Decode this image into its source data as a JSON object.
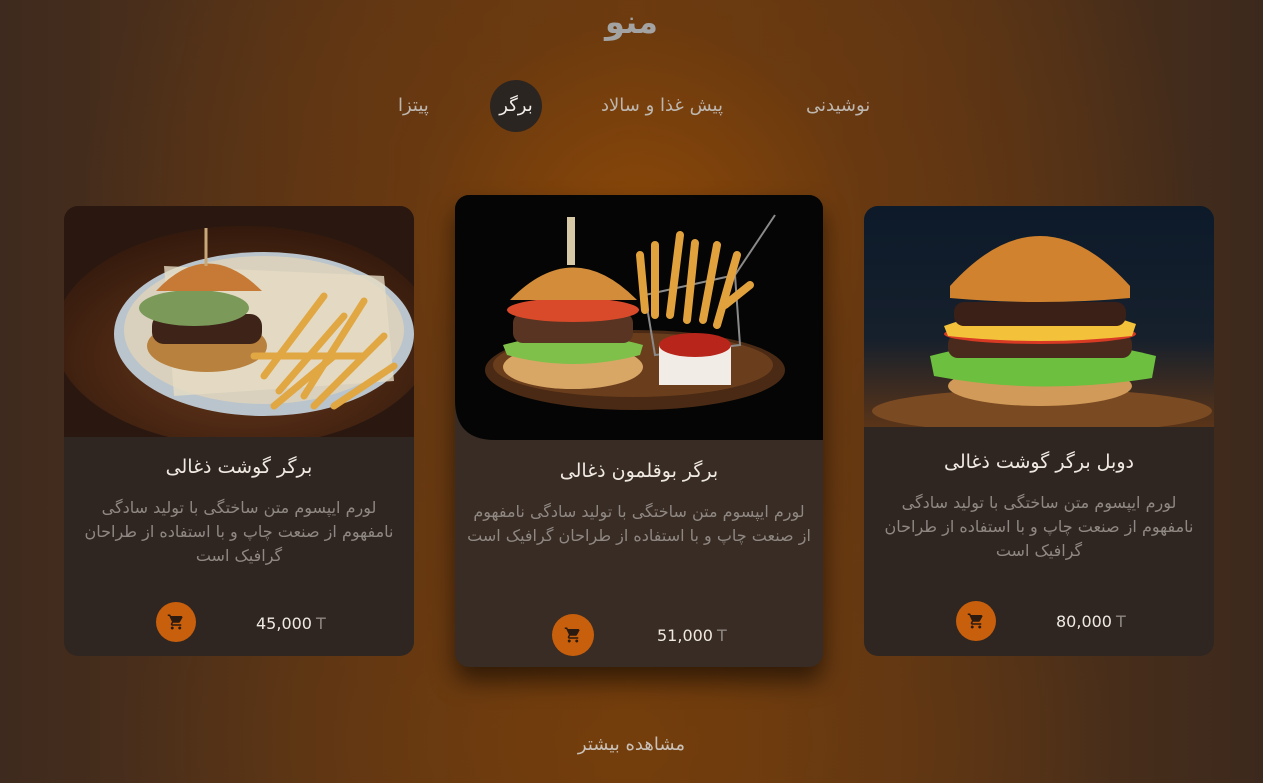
{
  "page": {
    "title": "منو"
  },
  "tabs": [
    {
      "label": "نوشیدنی",
      "active": false
    },
    {
      "label": "پیش غذا و سالاد",
      "active": false
    },
    {
      "label": "برگر",
      "active": true
    },
    {
      "label": "پیتزا",
      "active": false
    }
  ],
  "products": [
    {
      "name": "برگر گوشت ذغالی",
      "description": "لورم ایپسوم متن ساختگی با تولید سادگی نامفهوم از صنعت چاپ و با استفاده از طراحان گرافیک است",
      "price": "45,000",
      "currency": "T",
      "cart_icon": "shopping-cart-icon"
    },
    {
      "name": "برگر بوقلمون ذغالی",
      "description": "لورم ایپسوم متن ساختگی با تولید سادگی نامفهوم از صنعت چاپ و با استفاده از طراحان گرافیک است",
      "price": "51,000",
      "currency": "T",
      "cart_icon": "shopping-cart-icon"
    },
    {
      "name": "دوبل برگر گوشت ذغالی",
      "description": "لورم ایپسوم متن ساختگی با تولید سادگی نامفهوم از صنعت چاپ و با استفاده از طراحان گرافیک است",
      "price": "80,000",
      "currency": "T",
      "cart_icon": "shopping-cart-icon"
    }
  ],
  "footer": {
    "more_label": "مشاهده بیشتر"
  },
  "colors": {
    "accent": "#c85f0c",
    "card": "#2f2622",
    "card_featured": "#382c24"
  }
}
